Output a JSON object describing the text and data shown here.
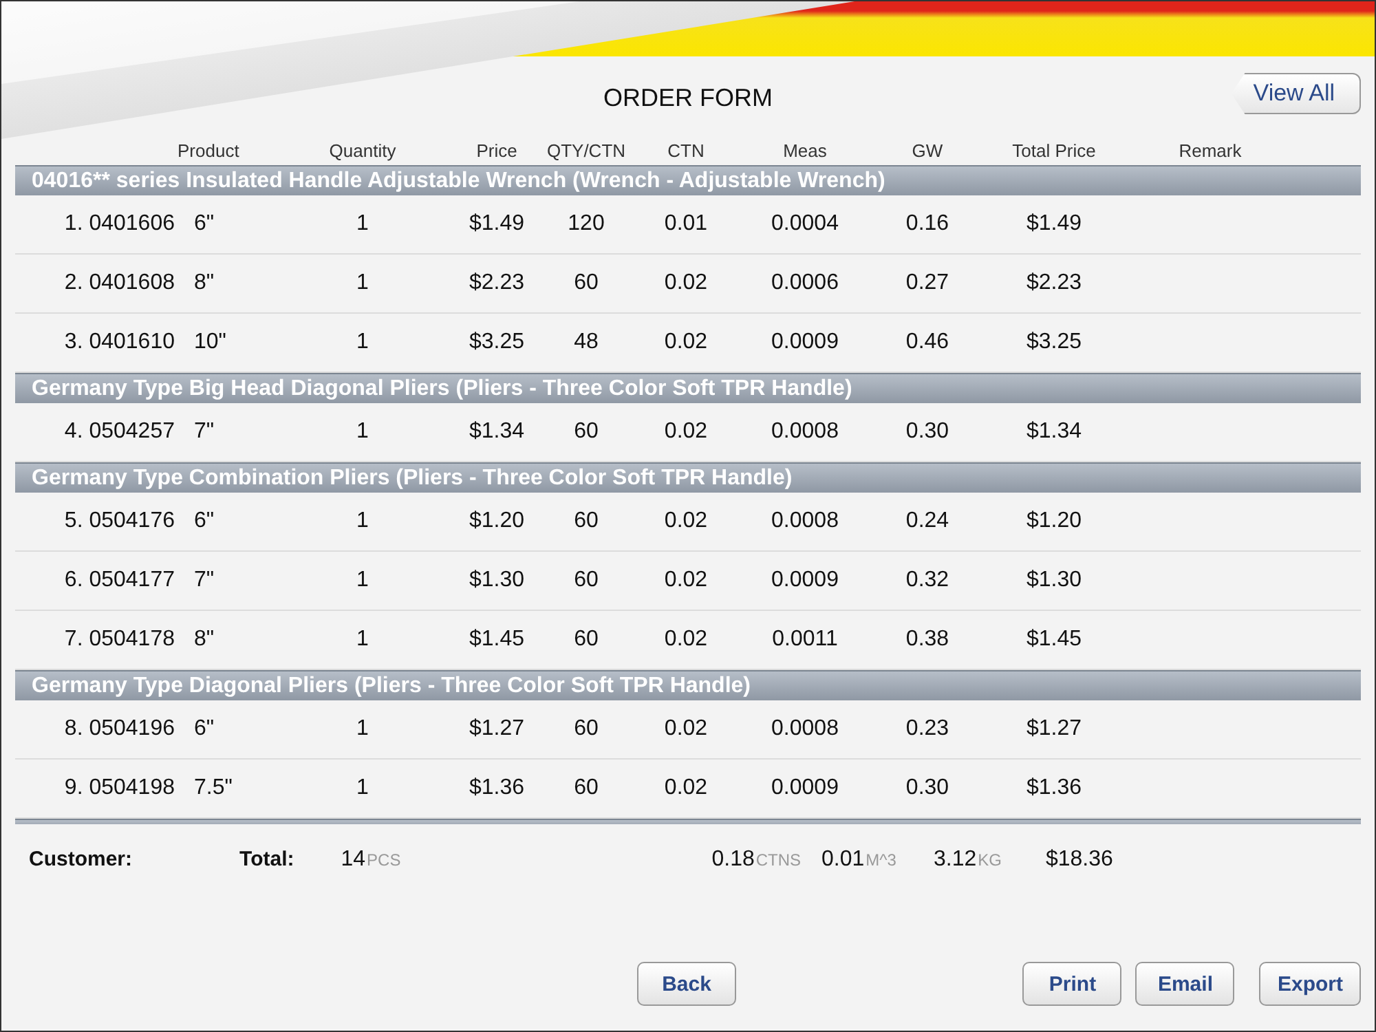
{
  "title": "ORDER FORM",
  "view_all": "View All",
  "columns": [
    "Product",
    "Quantity",
    "Price",
    "QTY/CTN",
    "CTN",
    "Meas",
    "GW",
    "Total Price",
    "Remark"
  ],
  "groups": [
    {
      "title": "04016** series Insulated Handle Adjustable Wrench (Wrench - Adjustable Wrench)",
      "rows": [
        {
          "item": "1. 0401606",
          "size": "6\"",
          "qty": "1",
          "price": "$1.49",
          "qty_ctn": "120",
          "ctn": "0.01",
          "meas": "0.0004",
          "gw": "0.16",
          "total": "$1.49"
        },
        {
          "item": "2. 0401608",
          "size": "8\"",
          "qty": "1",
          "price": "$2.23",
          "qty_ctn": "60",
          "ctn": "0.02",
          "meas": "0.0006",
          "gw": "0.27",
          "total": "$2.23"
        },
        {
          "item": "3. 0401610",
          "size": "10\"",
          "qty": "1",
          "price": "$3.25",
          "qty_ctn": "48",
          "ctn": "0.02",
          "meas": "0.0009",
          "gw": "0.46",
          "total": "$3.25"
        }
      ]
    },
    {
      "title": "Germany Type Big Head Diagonal Pliers (Pliers - Three Color Soft TPR Handle)",
      "rows": [
        {
          "item": "4. 0504257",
          "size": "7\"",
          "qty": "1",
          "price": "$1.34",
          "qty_ctn": "60",
          "ctn": "0.02",
          "meas": "0.0008",
          "gw": "0.30",
          "total": "$1.34"
        }
      ]
    },
    {
      "title": "Germany Type Combination Pliers (Pliers - Three Color Soft TPR Handle)",
      "rows": [
        {
          "item": "5. 0504176",
          "size": "6\"",
          "qty": "1",
          "price": "$1.20",
          "qty_ctn": "60",
          "ctn": "0.02",
          "meas": "0.0008",
          "gw": "0.24",
          "total": "$1.20"
        },
        {
          "item": "6. 0504177",
          "size": "7\"",
          "qty": "1",
          "price": "$1.30",
          "qty_ctn": "60",
          "ctn": "0.02",
          "meas": "0.0009",
          "gw": "0.32",
          "total": "$1.30"
        },
        {
          "item": "7. 0504178",
          "size": "8\"",
          "qty": "1",
          "price": "$1.45",
          "qty_ctn": "60",
          "ctn": "0.02",
          "meas": "0.0011",
          "gw": "0.38",
          "total": "$1.45"
        }
      ]
    },
    {
      "title": "Germany Type Diagonal Pliers (Pliers - Three Color Soft TPR Handle)",
      "rows": [
        {
          "item": "8. 0504196",
          "size": "6\"",
          "qty": "1",
          "price": "$1.27",
          "qty_ctn": "60",
          "ctn": "0.02",
          "meas": "0.0008",
          "gw": "0.23",
          "total": "$1.27"
        },
        {
          "item": "9. 0504198",
          "size": "7.5\"",
          "qty": "1",
          "price": "$1.36",
          "qty_ctn": "60",
          "ctn": "0.02",
          "meas": "0.0009",
          "gw": "0.30",
          "total": "$1.36"
        }
      ]
    }
  ],
  "summary": {
    "customer_label": "Customer:",
    "total_label": "Total:",
    "pcs": "14",
    "pcs_unit": "PCS",
    "ctns": "0.18",
    "ctns_unit": "CTNS",
    "meas": "0.01",
    "meas_unit": "M^3",
    "kg": "3.12",
    "kg_unit": "KG",
    "price": "$18.36"
  },
  "buttons": {
    "back": "Back",
    "actions": [
      "Print",
      "Email",
      "Export"
    ]
  }
}
